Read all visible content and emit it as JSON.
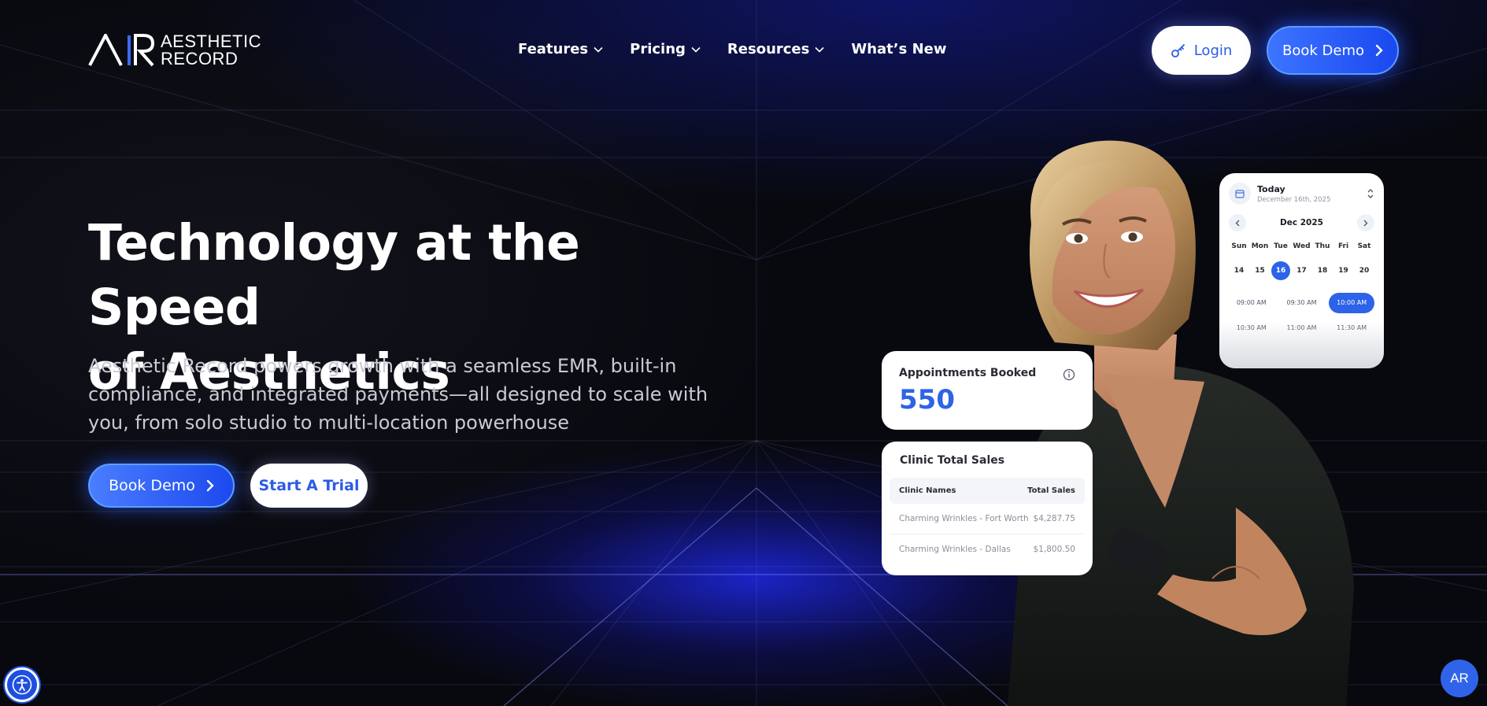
{
  "brand": {
    "logo_line1": "AESTHETIC",
    "logo_line2": "RECORD",
    "accent": "#2d63e8"
  },
  "nav": {
    "items": [
      {
        "label": "Features",
        "has_dropdown": true
      },
      {
        "label": "Pricing",
        "has_dropdown": true
      },
      {
        "label": "Resources",
        "has_dropdown": true
      },
      {
        "label": "What’s New",
        "has_dropdown": false
      }
    ],
    "login_label": "Login",
    "book_demo_label": "Book Demo"
  },
  "hero": {
    "title_line1": "Technology at the Speed",
    "title_line2": "of Aesthetics",
    "subtitle": "Aesthetic Record powers growth with a seamless EMR, built-in compliance, and integrated payments—all designed to scale with you, from solo studio to multi-location powerhouse",
    "primary_cta": "Book Demo",
    "secondary_cta": "Start A Trial"
  },
  "appointments_card": {
    "label": "Appointments Booked",
    "value": "550"
  },
  "sales_card": {
    "title": "Clinic Total Sales",
    "columns": [
      "Clinic Names",
      "Total Sales"
    ],
    "rows": [
      [
        "Charming Wrinkles - Fort Worth",
        "$4,287.75"
      ],
      [
        "Charming Wrinkles - Dallas",
        "$1,800.50"
      ]
    ]
  },
  "calendar_card": {
    "today_label": "Today",
    "today_date": "December 16th, 2025",
    "month": "Dec 2025",
    "weekdays": [
      "Sun",
      "Mon",
      "Tue",
      "Wed",
      "Thu",
      "Fri",
      "Sat"
    ],
    "dates": [
      "14",
      "15",
      "16",
      "17",
      "18",
      "19",
      "20"
    ],
    "selected_date": "16",
    "times": [
      "09:00 AM",
      "09:30 AM",
      "10:00 AM",
      "10:30 AM",
      "11:00 AM",
      "11:30 AM"
    ],
    "selected_time": "10:00 AM"
  },
  "chat_widget_label": "AR"
}
